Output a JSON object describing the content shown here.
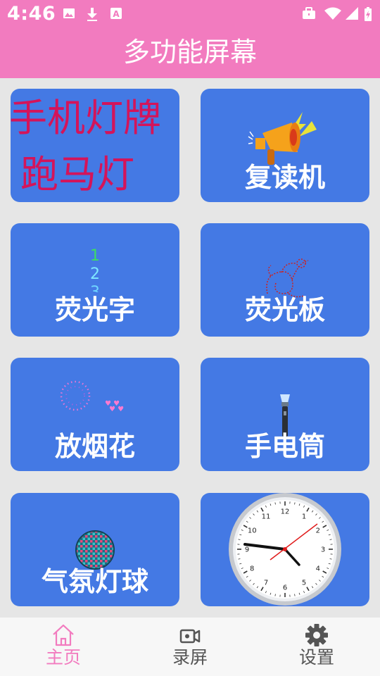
{
  "status_bar": {
    "time": "4:46",
    "left_icons": [
      "image-icon",
      "download-icon",
      "text-icon"
    ],
    "right_icons": [
      "briefcase-icon",
      "wifi-icon",
      "signal-icon",
      "battery-charging-icon"
    ]
  },
  "header": {
    "title": "多功能屏幕"
  },
  "cards": [
    {
      "label_line1": "手机灯牌",
      "label_line2": "跑马灯",
      "color": "#d4145a"
    },
    {
      "label": "复读机",
      "icon": "megaphone-icon"
    },
    {
      "label": "荧光字",
      "icon": "glow-numbers-icon",
      "digits": [
        "1",
        "2",
        "3"
      ]
    },
    {
      "label": "荧光板",
      "icon": "dragon-doodle-icon"
    },
    {
      "label": "放烟花",
      "icon": "firework-hearts-icon"
    },
    {
      "label": "手电筒",
      "icon": "flashlight-icon"
    },
    {
      "label": "气氛灯球",
      "icon": "disco-ball-icon"
    },
    {
      "label": "",
      "icon": "clock-icon",
      "numbers": [
        "12",
        "1",
        "2",
        "3",
        "4",
        "5",
        "6",
        "7",
        "8",
        "9",
        "10",
        "11"
      ]
    }
  ],
  "bottom_nav": {
    "items": [
      {
        "label": "主页",
        "icon": "home-icon",
        "active": true
      },
      {
        "label": "录屏",
        "icon": "video-record-icon",
        "active": false
      },
      {
        "label": "设置",
        "icon": "gear-icon",
        "active": false
      }
    ],
    "active_color": "#f27bbf",
    "inactive_color": "#555555"
  },
  "colors": {
    "header": "#f27bbf",
    "card": "#4479e4",
    "background": "#e6e6e6"
  }
}
